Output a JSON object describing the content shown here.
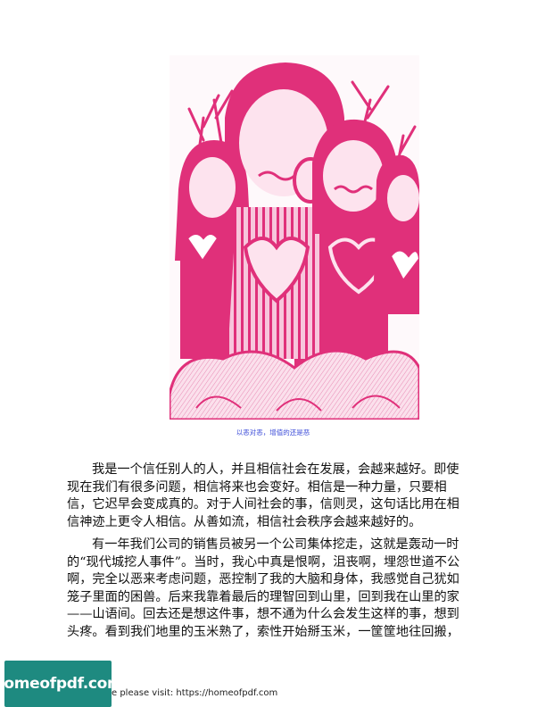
{
  "caption": "以恶对恶，增值的还是恶",
  "paragraph1": [
    "我是一个信任别人的人，并且相信社会在发展，会越来越好。即使",
    "现在我们有很多问题，相信将来也会变好。相信是一种力量，只要相",
    "信，它迟早会变成真的。对于人间社会的事，信则灵，这句话比用在相",
    "信神迹上更令人相信。从善如流，相信社会秩序会越来越好的。"
  ],
  "paragraph2": [
    "有一年我们公司的销售员被另一个公司集体挖走，这就是轰动一时",
    "的“现代城挖人事件”。当时，我心中真是恨啊，沮丧啊，埋怨世道不公",
    "啊，完全以恶来考虑问题，恶控制了我的大脑和身体，我感觉自己犹如",
    "笼子里面的困兽。后来我靠着最后的理智回到山里，回到我在山里的家",
    "——山语间。回去还是想这件事，想不通为什么会发生这样的事，想到",
    "头疼。看到我们地里的玉米熟了，索性开始掰玉米，一筐筐地往回搬，"
  ],
  "footer": {
    "badge": "homeofpdf.com",
    "text": "e please visit: https://homeofpdf.com"
  },
  "colors": {
    "accent": "#e0307a",
    "caption": "#3a4ad8",
    "badge": "#1e8a80"
  }
}
